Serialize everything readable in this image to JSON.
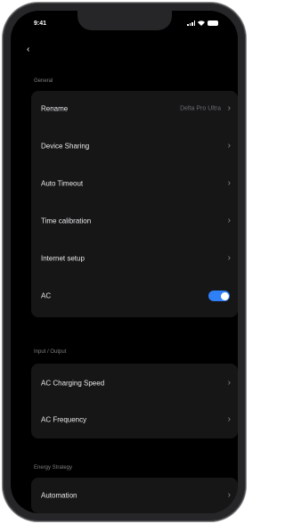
{
  "status_bar": {
    "time": "9:41",
    "icons": [
      "signal-icon",
      "wifi-icon",
      "battery-icon"
    ]
  },
  "nav": {
    "back_icon": "chevron-left-icon",
    "back_glyph": "‹"
  },
  "sections": {
    "general": {
      "label": "General",
      "rows": [
        {
          "label": "Rename",
          "value": "Delta Pro Ultra",
          "chevron": "›"
        },
        {
          "label": "Device Sharing",
          "chevron": "›"
        },
        {
          "label": "Auto Timeout",
          "chevron": "›"
        },
        {
          "label": "Time calibration",
          "chevron": "›"
        },
        {
          "label": "Internet setup",
          "chevron": "›"
        },
        {
          "label": "AC",
          "toggle_on": true
        }
      ]
    },
    "io": {
      "label": "Input / Output",
      "rows": [
        {
          "label": "AC Charging Speed",
          "chevron": "›"
        },
        {
          "label": "AC Frequency",
          "chevron": "›"
        }
      ]
    },
    "energy": {
      "label": "Energy Strategy",
      "rows": [
        {
          "label": "Automation",
          "chevron": "›"
        }
      ]
    }
  },
  "colors": {
    "background": "#000000",
    "card": "#161617",
    "accent": "#2f7ff6",
    "text": "#e8e8ea",
    "secondary_text": "#7f7f84"
  }
}
